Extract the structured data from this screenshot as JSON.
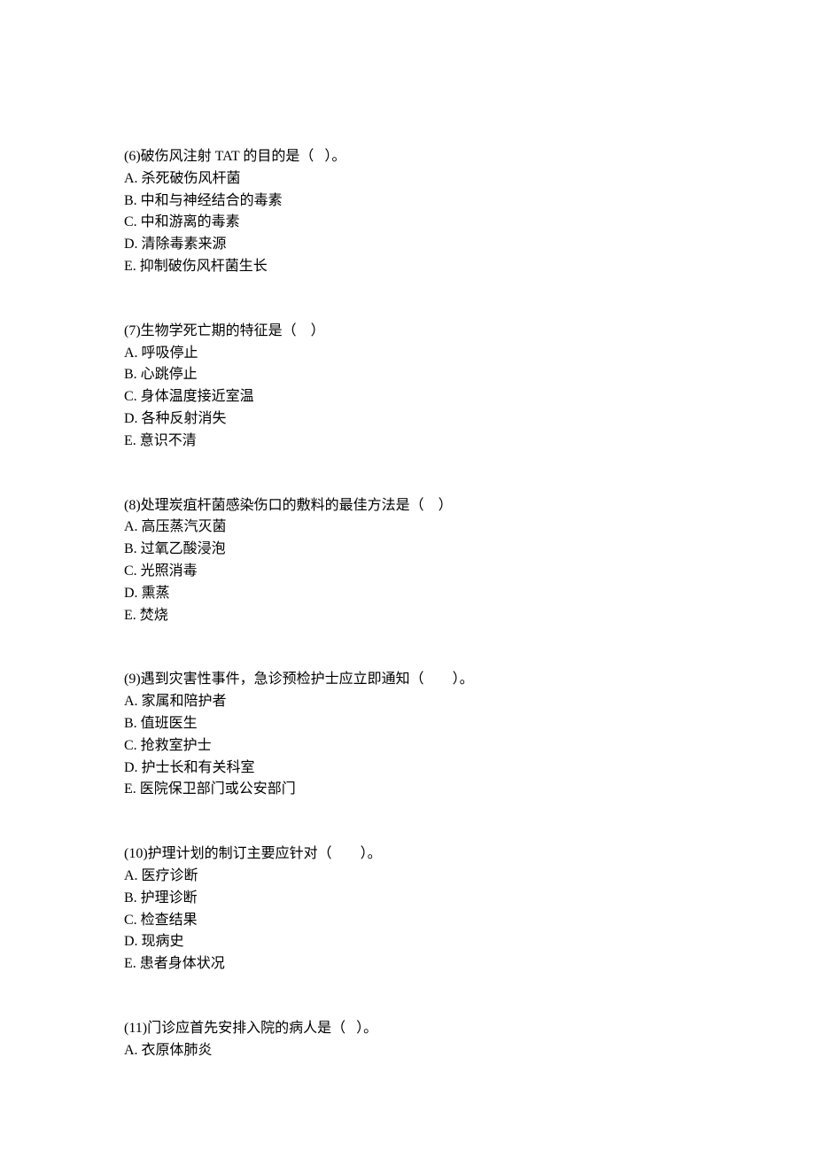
{
  "questions": [
    {
      "stem": "(6)破伤风注射 TAT 的目的是（   ）。",
      "options": [
        "A. 杀死破伤风杆菌",
        "B. 中和与神经结合的毒素",
        "C. 中和游离的毒素",
        "D. 清除毒素来源",
        "E. 抑制破伤风杆菌生长"
      ]
    },
    {
      "stem": "(7)生物学死亡期的特征是（　）",
      "options": [
        "A. 呼吸停止",
        "B. 心跳停止",
        "C. 身体温度接近室温",
        "D. 各种反射消失",
        "E. 意识不清"
      ]
    },
    {
      "stem": "(8)处理炭疽杆菌感染伤口的敷料的最佳方法是（　）",
      "options": [
        "A. 高压蒸汽灭菌",
        "B. 过氧乙酸浸泡",
        "C. 光照消毒",
        "D. 熏蒸",
        "E. 焚烧"
      ]
    },
    {
      "stem": "(9)遇到灾害性事件，急诊预检护士应立即通知（　　）。",
      "options": [
        "A. 家属和陪护者",
        "B. 值班医生",
        "C. 抢救室护士",
        "D. 护士长和有关科室",
        "E. 医院保卫部门或公安部门"
      ]
    },
    {
      "stem": "(10)护理计划的制订主要应针对（　　）。",
      "options": [
        "A. 医疗诊断",
        "B. 护理诊断",
        "C. 检查结果",
        "D. 现病史",
        "E. 患者身体状况"
      ]
    },
    {
      "stem": "(11)门诊应首先安排入院的病人是（   ）。",
      "options": [
        "A. 衣原体肺炎"
      ]
    }
  ]
}
